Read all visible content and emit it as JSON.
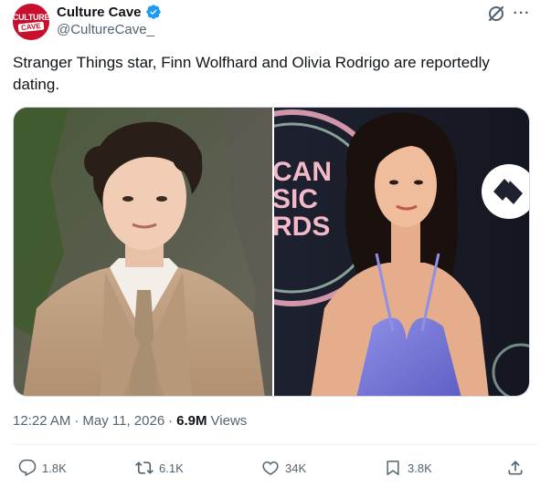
{
  "author": {
    "display_name": "Culture Cave",
    "handle": "@CultureCave_",
    "avatar_text_top": "CULTURE",
    "avatar_text_bottom": "CAVE",
    "verified": true,
    "verified_color": "#1d9bf0",
    "avatar_color": "#c8102e"
  },
  "tweet": {
    "text": "Stranger Things star, Finn Wolfhard and Olivia Rodrigo are reportedly dating.",
    "photo_right_sign_text": [
      "CAN",
      "SIC",
      "RDS"
    ]
  },
  "meta": {
    "time": "12:22 AM",
    "separator1": "·",
    "date": "May 11, 2026",
    "separator2": "·",
    "views_count": "6.9M",
    "views_label": "Views"
  },
  "actions": {
    "replies": "1.8K",
    "reposts": "6.1K",
    "likes": "34K",
    "bookmarks": "3.8K"
  },
  "icons": {
    "grok": "grok-icon",
    "more": "more-icon",
    "reply": "reply-icon",
    "repost": "repost-icon",
    "like": "heart-icon",
    "bookmark": "bookmark-icon",
    "share": "share-icon"
  },
  "colors": {
    "text_primary": "#0f1419",
    "text_secondary": "#536471",
    "divider": "#eff3f4"
  }
}
